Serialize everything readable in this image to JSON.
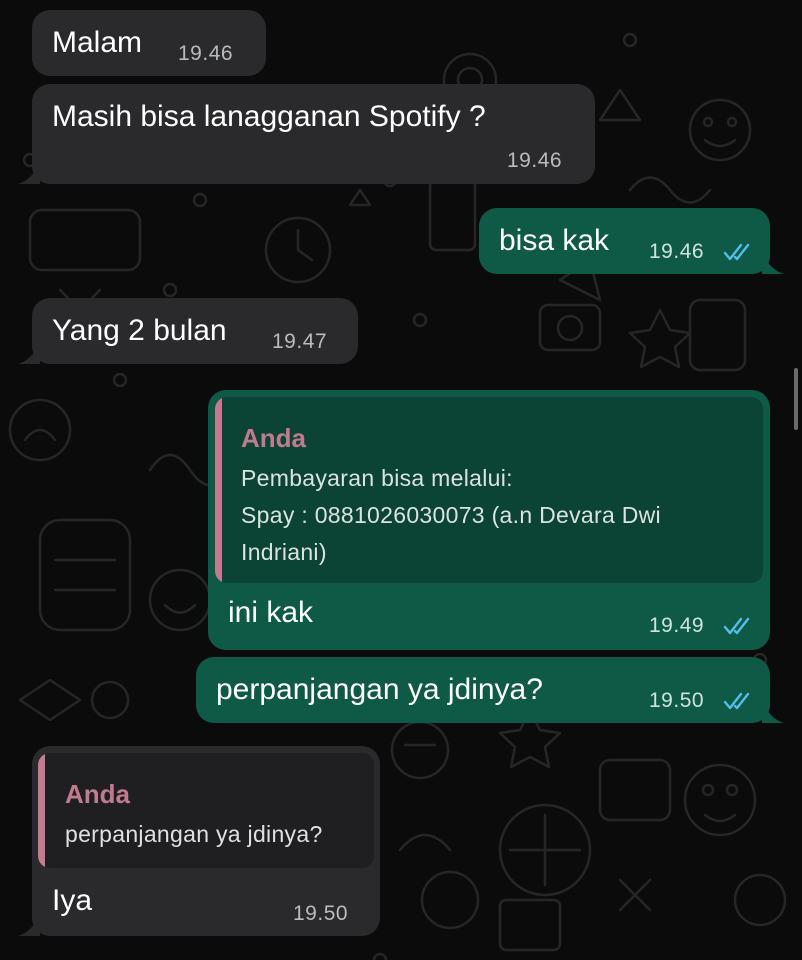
{
  "colors": {
    "incoming": "#2a2a2c",
    "outgoing": "#0f5a47",
    "read_ticks": "#53bdeb",
    "quote_name": "#c07b8e"
  },
  "messages": {
    "m1": {
      "text": "Malam",
      "time": "19.46"
    },
    "m2": {
      "text": "Masih bisa lanagganan Spotify ?",
      "time": "19.46"
    },
    "m3": {
      "text": "bisa kak",
      "time": "19.46",
      "status_icon": "double-check-read-icon"
    },
    "m4": {
      "text": "Yang 2 bulan",
      "time": "19.47"
    },
    "m5": {
      "quote": {
        "name": "Anda",
        "line1": "Pembayaran bisa melalui:",
        "line2": "Spay : 0881026030073 (a.n Devara Dwi",
        "line3": "Indriani)"
      },
      "text": "ini kak",
      "time": "19.49",
      "status_icon": "double-check-read-icon"
    },
    "m6": {
      "text": "perpanjangan ya jdinya?",
      "time": "19.50",
      "status_icon": "double-check-read-icon"
    },
    "m7": {
      "quote": {
        "name": "Anda",
        "line1": "perpanjangan ya jdinya?"
      },
      "text": "Iya",
      "time": "19.50"
    }
  }
}
